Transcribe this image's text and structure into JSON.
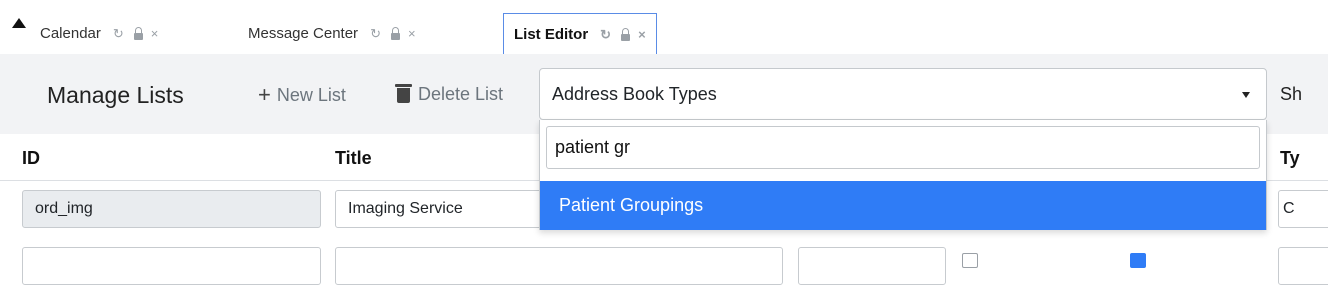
{
  "tabs": [
    {
      "label": "Calendar",
      "active": false
    },
    {
      "label": "Message Center",
      "active": false
    },
    {
      "label": "List Editor",
      "active": true
    }
  ],
  "tab_icons": {
    "refresh": "↻",
    "lock": "lock-icon",
    "close": "×"
  },
  "toolbar": {
    "title": "Manage Lists",
    "new_list": "New List",
    "delete_list": "Delete List",
    "selected_list": "Address Book Types",
    "show_partial": "Sh"
  },
  "dropdown": {
    "search_value": "patient gr",
    "highlighted_option": "Patient Groupings"
  },
  "table": {
    "headers": {
      "id": "ID",
      "title": "Title",
      "type_partial": "Ty"
    },
    "rows": [
      {
        "id": "ord_img",
        "title": "Imaging Service",
        "type_partial": "C"
      }
    ]
  },
  "colors": {
    "accent": "#2f7cf6",
    "toolbar_bg": "#f2f3f5"
  }
}
